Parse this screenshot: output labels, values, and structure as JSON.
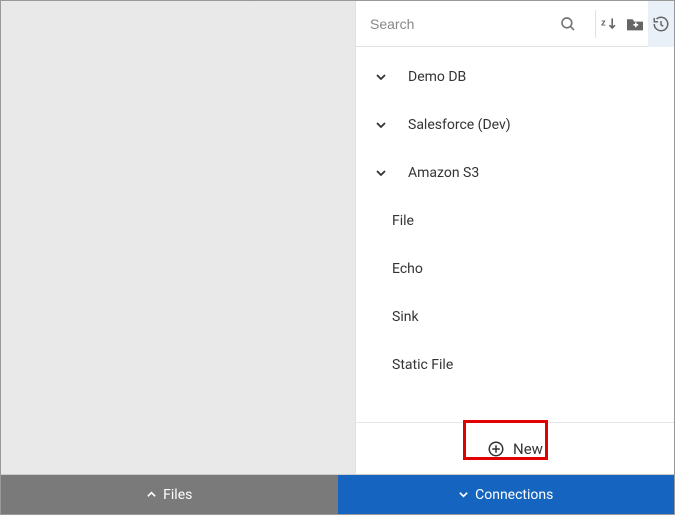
{
  "panel": {
    "search": {
      "placeholder": "Search"
    },
    "toolbar": {
      "search_icon": "search-icon",
      "sort_icon": "sort-icon",
      "add_folder_icon": "add-folder-icon",
      "history_icon": "history-icon"
    },
    "tree": [
      {
        "label": "Demo DB",
        "expandable": true
      },
      {
        "label": "Salesforce (Dev)",
        "expandable": true
      },
      {
        "label": "Amazon S3",
        "expandable": true
      },
      {
        "label": "File",
        "expandable": false
      },
      {
        "label": "Echo",
        "expandable": false
      },
      {
        "label": "Sink",
        "expandable": false
      },
      {
        "label": "Static File",
        "expandable": false
      }
    ],
    "new_label": "New"
  },
  "tabs": {
    "files": "Files",
    "connections": "Connections"
  },
  "colors": {
    "tab_files_bg": "#7a7a7a",
    "tab_connections_bg": "#1565c0",
    "highlight_border": "#e30000"
  }
}
